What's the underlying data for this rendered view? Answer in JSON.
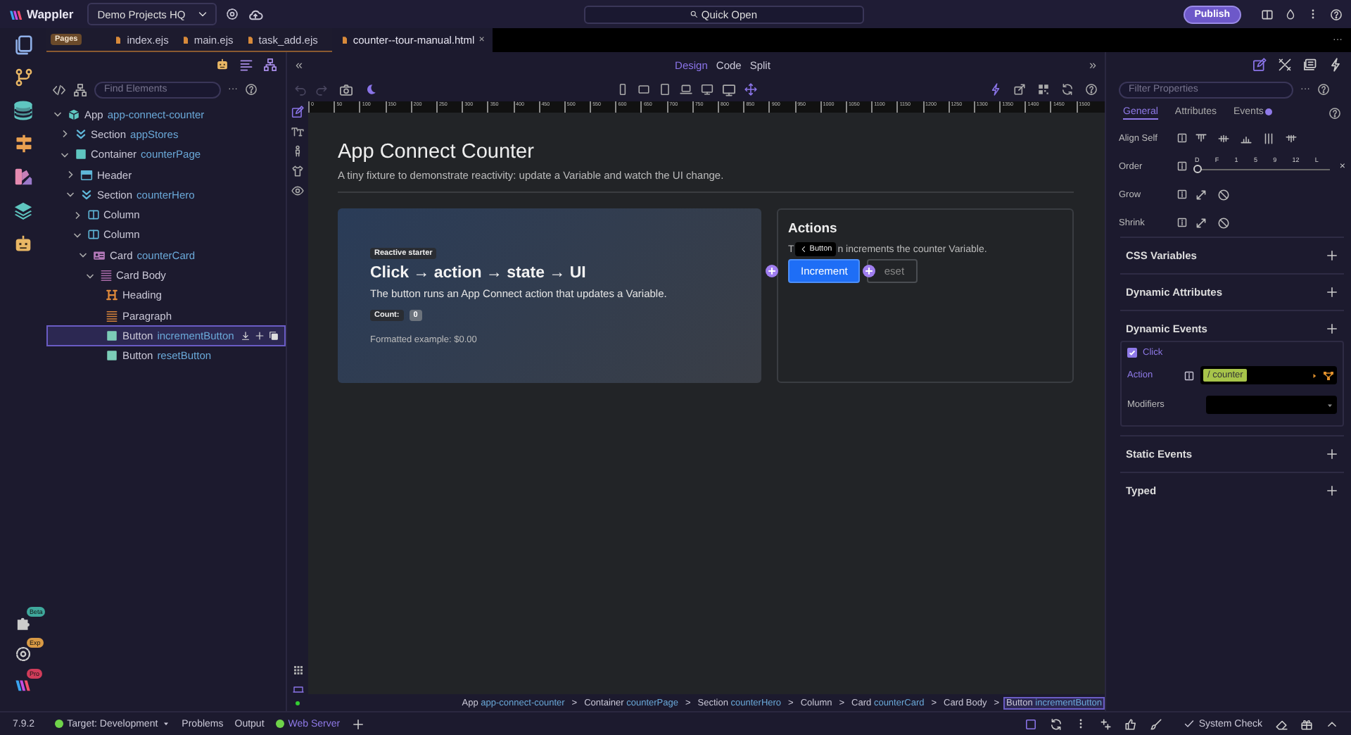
{
  "app_bar": {
    "logo": "Wappler",
    "project": "Demo Projects HQ",
    "search": "Quick Open",
    "publish": "Publish"
  },
  "activity_badges": [
    {
      "label": "Beta",
      "color": "#3fa89c"
    },
    {
      "label": "Exp",
      "color": "#d99a45"
    },
    {
      "label": "Pro",
      "color": "#d03c5a"
    }
  ],
  "file_tabs": {
    "group": "Pages",
    "overflow": "···",
    "tabs": [
      {
        "label": "index.ejs",
        "selected": false
      },
      {
        "label": "main.ejs",
        "selected": false
      },
      {
        "label": "task_add.ejs",
        "selected": false
      },
      {
        "label": "counter--tour-manual.html",
        "selected": true,
        "close": "×"
      }
    ]
  },
  "structure_panel": {
    "search_placeholder": "Find Elements",
    "more": "···",
    "tree": [
      {
        "type": "App",
        "name": "app-connect-counter",
        "kind": "app",
        "expanded": true,
        "selected": false,
        "children": [
          {
            "type": "Section",
            "name": "appStores",
            "kind": "section",
            "expanded": false,
            "selected": false
          },
          {
            "type": "Container",
            "name": "counterPage",
            "kind": "container",
            "expanded": true,
            "selected": false,
            "children": [
              {
                "type": "Header",
                "kind": "header",
                "expanded": false,
                "selected": false
              },
              {
                "type": "Section",
                "name": "counterHero",
                "kind": "section",
                "expanded": true,
                "selected": false,
                "children": [
                  {
                    "type": "Column",
                    "kind": "column",
                    "expanded": false,
                    "selected": false
                  },
                  {
                    "type": "Column",
                    "kind": "column",
                    "expanded": true,
                    "selected": false,
                    "children": [
                      {
                        "type": "Card",
                        "name": "counterCard",
                        "kind": "card",
                        "expanded": true,
                        "selected": false,
                        "children": [
                          {
                            "type": "Card Body",
                            "kind": "card-body",
                            "expanded": true,
                            "selected": false,
                            "children": [
                              {
                                "type": "Heading",
                                "kind": "heading",
                                "selected": false
                              },
                              {
                                "type": "Paragraph",
                                "kind": "paragraph",
                                "selected": false
                              },
                              {
                                "type": "Button",
                                "name": "incrementButton",
                                "kind": "button",
                                "selected": true
                              },
                              {
                                "type": "Button",
                                "name": "resetButton",
                                "kind": "button",
                                "selected": false
                              }
                            ]
                          }
                        ]
                      }
                    ]
                  }
                ]
              }
            ]
          }
        ]
      }
    ]
  },
  "view_tabs": {
    "collapse_left": "«",
    "collapse_right": "»",
    "modes": [
      {
        "label": "Design",
        "selected": true
      },
      {
        "label": "Code",
        "selected": false
      },
      {
        "label": "Split",
        "selected": false
      }
    ]
  },
  "ruler": [
    "0",
    "50",
    "100",
    "150",
    "200",
    "250",
    "300",
    "350",
    "400",
    "450",
    "500",
    "550",
    "600",
    "650",
    "700",
    "750",
    "800",
    "850",
    "900",
    "950",
    "1000",
    "1050",
    "1100",
    "1150",
    "1200",
    "1250",
    "1300",
    "1350",
    "1400",
    "1450",
    "1500"
  ],
  "page": {
    "title": "App Connect Counter",
    "subtitle": "A tiny fixture to demonstrate reactivity: update a Variable and watch the UI change.",
    "hero": {
      "badge": "Reactive starter",
      "title": "Click → action → state → UI",
      "text": "The button runs an App Connect action that updates a Variable.",
      "count_label": "Count:",
      "count_value": "0",
      "formatted": "Formatted example: $0.00"
    },
    "actions": {
      "title": "Actions",
      "text_start": "T",
      "text": "n increments the counter Variable.",
      "tooltip": "Button",
      "buttons": [
        {
          "label": "Increment",
          "kind": "primary"
        },
        {
          "label": "eset",
          "kind": "outline"
        }
      ]
    }
  },
  "breadcrumb": {
    "separator": ">",
    "items": [
      {
        "type": "App",
        "name": "app-connect-counter",
        "selected": false
      },
      {
        "type": "Container",
        "name": "counterPage",
        "selected": false
      },
      {
        "type": "Section",
        "name": "counterHero",
        "selected": false
      },
      {
        "type": "Column",
        "selected": false
      },
      {
        "type": "Card",
        "name": "counterCard",
        "selected": false
      },
      {
        "type": "Card Body",
        "selected": false
      },
      {
        "type": "Button",
        "name": "incrementButton",
        "selected": true
      }
    ]
  },
  "properties": {
    "filter_placeholder": "Filter Properties",
    "more": "···",
    "tabs": [
      {
        "label": "General",
        "selected": true,
        "marked": false
      },
      {
        "label": "Attributes",
        "selected": false,
        "marked": false
      },
      {
        "label": "Events",
        "selected": false,
        "marked": true
      }
    ],
    "flex": [
      {
        "label": "Align Self",
        "kind": "align"
      },
      {
        "label": "Order",
        "kind": "slider",
        "level": 0,
        "ticks": [
          "D",
          "F",
          "1",
          "5",
          "9",
          "12",
          "L"
        ],
        "clear": "×"
      },
      {
        "label": "Grow",
        "kind": "toggle"
      },
      {
        "label": "Shrink",
        "kind": "toggle"
      }
    ],
    "sections": [
      {
        "title": "CSS Variables"
      },
      {
        "title": "Dynamic Attributes"
      },
      {
        "title": "Dynamic Events",
        "events": [
          {
            "event": "Click",
            "checked": true,
            "action_label": "Action",
            "action_value": "/ counter",
            "modifiers_label": "Modifiers"
          }
        ]
      },
      {
        "title": "Static Events"
      },
      {
        "title": "Typed"
      }
    ]
  },
  "status_bar": {
    "version": "7.9.2",
    "target": {
      "label": "Target: Development",
      "on": true
    },
    "tabs": [
      "Problems",
      "Output"
    ],
    "server": {
      "label": "Web Server",
      "on": true
    },
    "system_check": "System Check"
  }
}
